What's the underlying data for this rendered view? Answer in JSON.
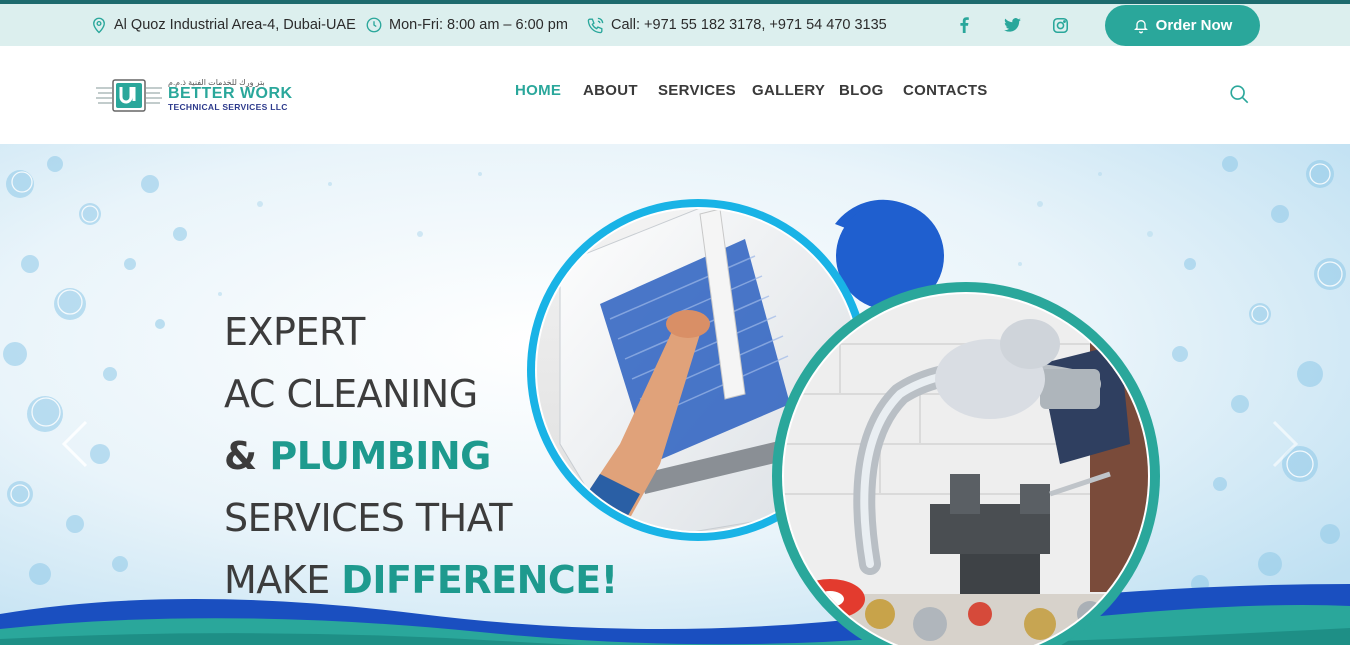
{
  "topbar": {
    "address": "Al Quoz Industrial Area-4, Dubai-UAE",
    "hours": "Mon-Fri: 8:00 am – 6:00 pm",
    "phone": "Call: +971 55 182 3178, +971 54 470 3135",
    "social": [
      "facebook-icon",
      "twitter-icon",
      "instagram-icon"
    ],
    "order_label": "Order Now"
  },
  "logo": {
    "arabic": "بتر ورك للخدمات الفنية ذ.م.م",
    "name": "BETTER WORK",
    "sub": "TECHNICAL SERVICES LLC"
  },
  "nav": {
    "items": [
      "HOME",
      "ABOUT",
      "SERVICES",
      "GALLERY",
      "BLOG",
      "CONTACTS"
    ],
    "active": "HOME"
  },
  "hero": {
    "line1": "EXPERT",
    "line2": "AC CLEANING",
    "line3_amp": "& ",
    "line3": "PLUMBING",
    "line4": "SERVICES THAT",
    "line5_a": "MAKE ",
    "line5_b": "DIFFERENCE!"
  },
  "colors": {
    "accent": "#2aa79b",
    "topbar_bg": "#dcefee",
    "heading_teal": "#1e9a8e",
    "brand_blue": "#2d3a8c"
  }
}
